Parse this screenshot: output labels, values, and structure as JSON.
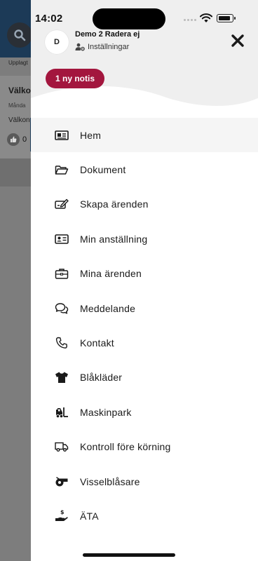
{
  "status_bar": {
    "time": "14:02"
  },
  "background": {
    "subtitle": "Upplagt",
    "card_title": "Välko",
    "card_date": "Månda",
    "card_text": "Välkon",
    "like_count": "0"
  },
  "profile": {
    "avatar_initial": "D",
    "name": "Demo 2 Radera ej",
    "settings_label": "Inställningar"
  },
  "notification": {
    "label": "1 ny notis",
    "color": "#a3163e"
  },
  "menu": {
    "items": [
      {
        "label": "Hem",
        "icon": "newspaper-icon",
        "active": true
      },
      {
        "label": "Dokument",
        "icon": "folder-icon"
      },
      {
        "label": "Skapa ärenden",
        "icon": "edit-ticket-icon"
      },
      {
        "label": "Min anställning",
        "icon": "id-card-icon"
      },
      {
        "label": "Mina ärenden",
        "icon": "briefcase-icon"
      },
      {
        "label": "Meddelande",
        "icon": "chat-icon"
      },
      {
        "label": "Kontakt",
        "icon": "phone-icon"
      },
      {
        "label": "Blåkläder",
        "icon": "shirt-icon"
      },
      {
        "label": "Maskinpark",
        "icon": "forklift-icon"
      },
      {
        "label": "Kontroll före körning",
        "icon": "truck-icon"
      },
      {
        "label": "Visselblåsare",
        "icon": "whistle-icon"
      },
      {
        "label": "ÄTA",
        "icon": "money-hand-icon"
      }
    ]
  },
  "colors": {
    "header_bg": "#1c3a57",
    "drawer_head_bg": "#efefef",
    "active_item_bg": "#f5f5f5"
  }
}
